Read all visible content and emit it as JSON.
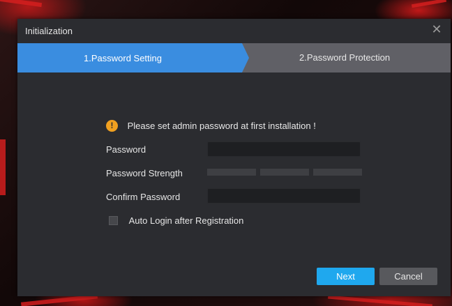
{
  "dialog": {
    "title": "Initialization",
    "close_icon": "close-icon"
  },
  "steps": [
    {
      "label": "1.Password Setting",
      "active": true
    },
    {
      "label": "2.Password Protection",
      "active": false
    }
  ],
  "notice": {
    "icon": "warning-icon",
    "text": "Please set admin password at first installation !"
  },
  "form": {
    "password_label": "Password",
    "password_value": "",
    "strength_label": "Password Strength",
    "strength_level": 0,
    "confirm_label": "Confirm Password",
    "confirm_value": "",
    "auto_login_label": "Auto Login after Registration",
    "auto_login_checked": false
  },
  "buttons": {
    "next_label": "Next",
    "cancel_label": "Cancel"
  },
  "colors": {
    "accent": "#1fa8ee",
    "step_active": "#3a8de0",
    "warning": "#f0a020",
    "dialog_bg": "#2b2c30"
  }
}
